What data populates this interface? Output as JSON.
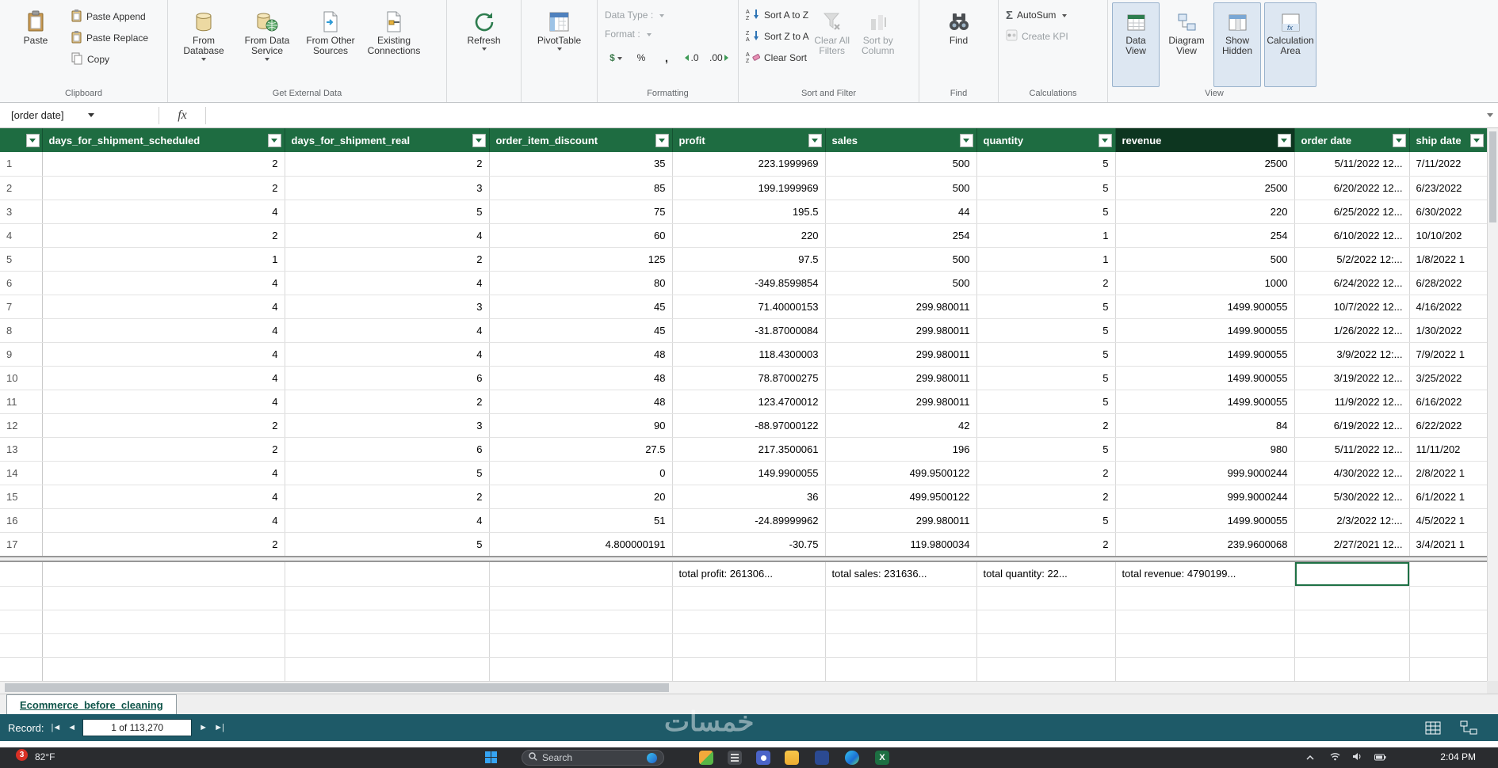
{
  "ribbon": {
    "clipboard": {
      "label": "Clipboard",
      "paste": "Paste",
      "paste_append": "Paste Append",
      "paste_replace": "Paste Replace",
      "copy": "Copy"
    },
    "external": {
      "label": "Get External Data",
      "from_database": "From Database",
      "from_data_service": "From Data Service",
      "from_other_sources": "From Other Sources",
      "existing_connections": "Existing Connections"
    },
    "refresh_group": {
      "label": "",
      "refresh": "Refresh"
    },
    "pivot_group": {
      "label": "",
      "pivottable": "PivotTable"
    },
    "formatting": {
      "label": "Formatting",
      "data_type": "Data Type :",
      "format": "Format :",
      "currency": "$",
      "percent": "%",
      "thousands": ",",
      "decimal_decrease": ".0",
      "decimal_increase": ".00"
    },
    "sort_filter": {
      "label": "Sort and Filter",
      "sort_az": "Sort A to Z",
      "sort_za": "Sort Z to A",
      "clear_sort": "Clear Sort",
      "clear_all_filters": "Clear All Filters",
      "sort_by_column": "Sort by Column"
    },
    "find_group": {
      "label": "Find",
      "find": "Find"
    },
    "calculations": {
      "label": "Calculations",
      "autosum": "AutoSum",
      "create_kpi": "Create KPI"
    },
    "view": {
      "label": "View",
      "data_view": "Data View",
      "diagram_view": "Diagram View",
      "show_hidden": "Show Hidden",
      "calculation_area": "Calculation Area"
    }
  },
  "icons": {
    "sigma": "Σ",
    "excel_letter": "X"
  },
  "formula_bar": {
    "name_box": "[order date]",
    "fx": "fx"
  },
  "grid": {
    "columns": [
      "days_for_shipment_scheduled",
      "days_for_shipment_real",
      "order_item_discount",
      "profit",
      "sales",
      "quantity",
      "revenue",
      "order date",
      "ship date"
    ],
    "rows": [
      [
        "2",
        "2",
        "35",
        "223.1999969",
        "500",
        "5",
        "2500",
        "5/11/2022 12...",
        "7/11/2022"
      ],
      [
        "2",
        "3",
        "85",
        "199.1999969",
        "500",
        "5",
        "2500",
        "6/20/2022 12...",
        "6/23/2022"
      ],
      [
        "4",
        "5",
        "75",
        "195.5",
        "44",
        "5",
        "220",
        "6/25/2022 12...",
        "6/30/2022"
      ],
      [
        "2",
        "4",
        "60",
        "220",
        "254",
        "1",
        "254",
        "6/10/2022 12...",
        "10/10/202"
      ],
      [
        "1",
        "2",
        "125",
        "97.5",
        "500",
        "1",
        "500",
        "5/2/2022 12:...",
        "1/8/2022 1"
      ],
      [
        "4",
        "4",
        "80",
        "-349.8599854",
        "500",
        "2",
        "1000",
        "6/24/2022 12...",
        "6/28/2022"
      ],
      [
        "4",
        "3",
        "45",
        "71.40000153",
        "299.980011",
        "5",
        "1499.900055",
        "10/7/2022 12...",
        "4/16/2022"
      ],
      [
        "4",
        "4",
        "45",
        "-31.87000084",
        "299.980011",
        "5",
        "1499.900055",
        "1/26/2022 12...",
        "1/30/2022"
      ],
      [
        "4",
        "4",
        "48",
        "118.4300003",
        "299.980011",
        "5",
        "1499.900055",
        "3/9/2022 12:...",
        "7/9/2022 1"
      ],
      [
        "4",
        "6",
        "48",
        "78.87000275",
        "299.980011",
        "5",
        "1499.900055",
        "3/19/2022 12...",
        "3/25/2022"
      ],
      [
        "4",
        "2",
        "48",
        "123.4700012",
        "299.980011",
        "5",
        "1499.900055",
        "11/9/2022 12...",
        "6/16/2022"
      ],
      [
        "2",
        "3",
        "90",
        "-88.97000122",
        "42",
        "2",
        "84",
        "6/19/2022 12...",
        "6/22/2022"
      ],
      [
        "2",
        "6",
        "27.5",
        "217.3500061",
        "196",
        "5",
        "980",
        "5/11/2022 12...",
        "11/11/202"
      ],
      [
        "4",
        "5",
        "0",
        "149.9900055",
        "499.9500122",
        "2",
        "999.9000244",
        "4/30/2022 12...",
        "2/8/2022 1"
      ],
      [
        "4",
        "2",
        "20",
        "36",
        "499.9500122",
        "2",
        "999.9000244",
        "5/30/2022 12...",
        "6/1/2022 1"
      ],
      [
        "4",
        "4",
        "51",
        "-24.89999962",
        "299.980011",
        "5",
        "1499.900055",
        "2/3/2022 12:...",
        "4/5/2022 1"
      ],
      [
        "2",
        "5",
        "4.800000191",
        "-30.75",
        "119.9800034",
        "2",
        "239.9600068",
        "2/27/2021 12...",
        "3/4/2021 1"
      ]
    ],
    "totals": {
      "profit": "total profit: 261306...",
      "sales": "total sales: 231636...",
      "quantity": "total quantity: 22...",
      "revenue": "total revenue: 4790199..."
    }
  },
  "sheet_tab": {
    "name": "Ecommerce_before_cleaning"
  },
  "status": {
    "record_label": "Record:",
    "nav_first": "|◄",
    "nav_prev": "◄",
    "record_value": "1 of 113,270",
    "nav_next": "►",
    "nav_last": "►|"
  },
  "watermark": {
    "text": "خمسات"
  },
  "taskbar": {
    "badge": "3",
    "temp": "82°F",
    "search": "Search",
    "time": "2:04 PM"
  }
}
